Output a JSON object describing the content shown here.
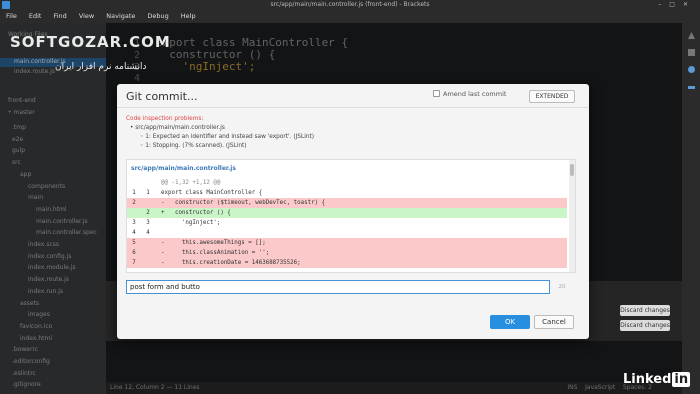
{
  "window": {
    "title": "src/app/main/main.controller.js (front-end) - Brackets"
  },
  "menu": [
    "File",
    "Edit",
    "Find",
    "View",
    "Navigate",
    "Debug",
    "Help"
  ],
  "watermark": {
    "brand": "SOFTGOZAR.COM",
    "tagline": "دانشنامه نرم افزار ایران"
  },
  "sidebar": {
    "working_files_label": "Working Files",
    "working_files": [
      "main.controller.js",
      "index.route.js"
    ],
    "project_name": "front-end",
    "branch": "master",
    "tree": [
      {
        "label": ".tmp",
        "indent": 1
      },
      {
        "label": "e2e",
        "indent": 1
      },
      {
        "label": "gulp",
        "indent": 1
      },
      {
        "label": "src",
        "indent": 1
      },
      {
        "label": "app",
        "indent": 2
      },
      {
        "label": "components",
        "indent": 3
      },
      {
        "label": "main",
        "indent": 3
      },
      {
        "label": "main.html",
        "indent": 4
      },
      {
        "label": "main.controller.js",
        "indent": 4
      },
      {
        "label": "main.controller.spec",
        "indent": 4
      },
      {
        "label": "index.scss",
        "indent": 3
      },
      {
        "label": "index.config.js",
        "indent": 3
      },
      {
        "label": "index.module.js",
        "indent": 3
      },
      {
        "label": "index.route.js",
        "indent": 3
      },
      {
        "label": "index.run.js",
        "indent": 3
      },
      {
        "label": "assets",
        "indent": 2
      },
      {
        "label": "images",
        "indent": 3
      },
      {
        "label": "favicon.ico",
        "indent": 2
      },
      {
        "label": "index.html",
        "indent": 2
      },
      {
        "label": ".bowerrc",
        "indent": 1
      },
      {
        "label": ".editorconfig",
        "indent": 1
      },
      {
        "label": ".eslintrc",
        "indent": 1
      },
      {
        "label": ".gitignore",
        "indent": 1
      }
    ]
  },
  "editor": {
    "lines": [
      {
        "n": "1",
        "code": "export class MainController {"
      },
      {
        "n": "2",
        "code": "  constructor () {"
      },
      {
        "n": "3",
        "code": "    'ngInject';"
      },
      {
        "n": "4",
        "code": ""
      }
    ]
  },
  "panel": {
    "discard_label": "Discard changes"
  },
  "dialog": {
    "title": "Git commit...",
    "amend_label": "Amend last commit",
    "extended_label": "EXTENDED",
    "problems": {
      "heading": "Code inspection problems:",
      "file": "src/app/main/main.controller.js",
      "items": [
        "1: Expected an identifier and instead saw 'export'. (JSLint)",
        "1: Stopping. (7% scanned). (JSLint)"
      ]
    },
    "diff": {
      "file": "src/app/main/main.controller.js",
      "lines": [
        {
          "type": "hunk",
          "a": "",
          "b": "",
          "text": "@@ -1,32 +1,12 @@"
        },
        {
          "type": "ctx",
          "a": "1",
          "b": "1",
          "text": "export class MainController {"
        },
        {
          "type": "del",
          "a": "2",
          "b": "",
          "text": "-   constructor ($timeout, webDevTec, toastr) {"
        },
        {
          "type": "add",
          "a": "",
          "b": "2",
          "text": "+   constructor () {"
        },
        {
          "type": "ctx",
          "a": "3",
          "b": "3",
          "text": "      'ngInject';"
        },
        {
          "type": "ctx",
          "a": "4",
          "b": "4",
          "text": ""
        },
        {
          "type": "del",
          "a": "5",
          "b": "",
          "text": "-     this.awesomeThings = [];"
        },
        {
          "type": "del",
          "a": "6",
          "b": "",
          "text": "-     this.classAnimation = '';"
        },
        {
          "type": "del",
          "a": "7",
          "b": "",
          "text": "-     this.creationDate = 1463688735526;"
        }
      ]
    },
    "message": "post form and butto",
    "message_length": "20",
    "ok_label": "OK",
    "cancel_label": "Cancel"
  },
  "status": {
    "left": "Line 12, Column 2 — 11 Lines",
    "ins": "INS",
    "language": "JavaScript",
    "spaces": "Spaces: 2"
  },
  "linkedin": {
    "text": "Linked",
    "in": "in"
  }
}
